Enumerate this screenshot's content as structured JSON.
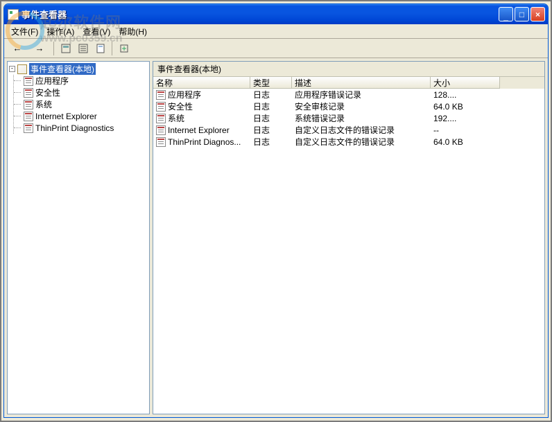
{
  "window": {
    "title": "事件查看器"
  },
  "menubar": {
    "file": "文件(F)",
    "action": "操作(A)",
    "view": "查看(V)",
    "help": "帮助(H)"
  },
  "watermark": {
    "text1": "起",
    "text2": "尔软件网",
    "url": "www.pc0359.cn"
  },
  "tree": {
    "root": "事件查看器(本地)",
    "items": [
      "应用程序",
      "安全性",
      "系统",
      "Internet Explorer",
      "ThinPrint Diagnostics"
    ]
  },
  "rightPanel": {
    "header": "事件查看器(本地)",
    "columns": {
      "name": "名称",
      "type": "类型",
      "desc": "描述",
      "size": "大小"
    },
    "rows": [
      {
        "name": "应用程序",
        "type": "日志",
        "desc": "应用程序错误记录",
        "size": "128...."
      },
      {
        "name": "安全性",
        "type": "日志",
        "desc": "安全审核记录",
        "size": "64.0 KB"
      },
      {
        "name": "系统",
        "type": "日志",
        "desc": "系统错误记录",
        "size": "192...."
      },
      {
        "name": "Internet Explorer",
        "type": "日志",
        "desc": "自定义日志文件的错误记录",
        "size": "--"
      },
      {
        "name": "ThinPrint Diagnos...",
        "type": "日志",
        "desc": "自定义日志文件的错误记录",
        "size": "64.0 KB"
      }
    ]
  }
}
